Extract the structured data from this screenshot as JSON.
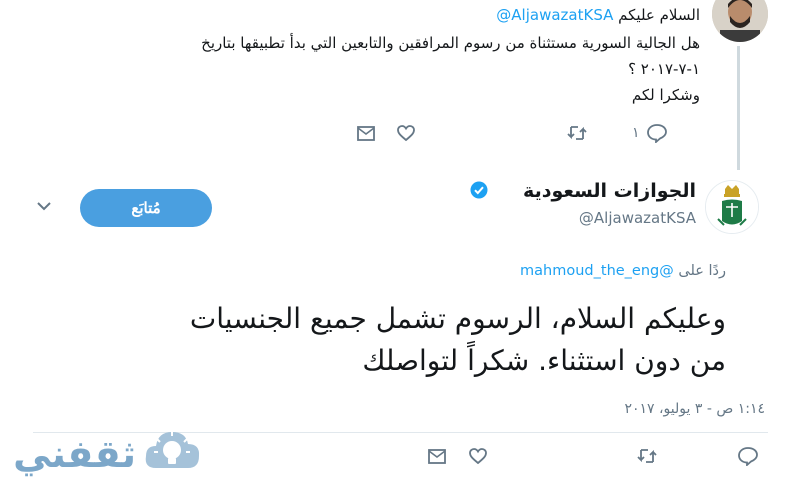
{
  "parent_tweet": {
    "reply_to_handle": "@AljawazatKSA",
    "greeting": "السلام عليكم",
    "lines": [
      "هل الجالية السورية مستثناة من رسوم المرافقين والتابعين التي بدأ تطبيقها بتاريخ",
      "١-٧-٢٠١٧ ؟",
      "وشكرا لكم"
    ],
    "reply_count": "١",
    "actions": {
      "reply": "reply-icon",
      "retweet": "retweet-icon",
      "like": "heart-icon",
      "dm": "envelope-icon"
    }
  },
  "main_tweet": {
    "display_name": "الجوازات السعودية",
    "handle": "@AljawazatKSA",
    "follow_label": "مُتابَع",
    "replying_prefix": "ردًا على",
    "replying_handle": "@mahmoud_the_eng",
    "text_lines": [
      "وعليكم السلام، الرسوم تشمل جميع الجنسيات",
      "من دون استثناء. شكراً لتواصلك"
    ],
    "timestamp": "١:١٤ ص - ٣ يوليو، ٢٠١٧"
  },
  "watermark": {
    "text": "ثقفني"
  },
  "colors": {
    "accent": "#1da1f2",
    "follow_button": "#4a9fe0",
    "muted": "#657786",
    "text": "#14171a",
    "verified": "#1da1f2"
  }
}
